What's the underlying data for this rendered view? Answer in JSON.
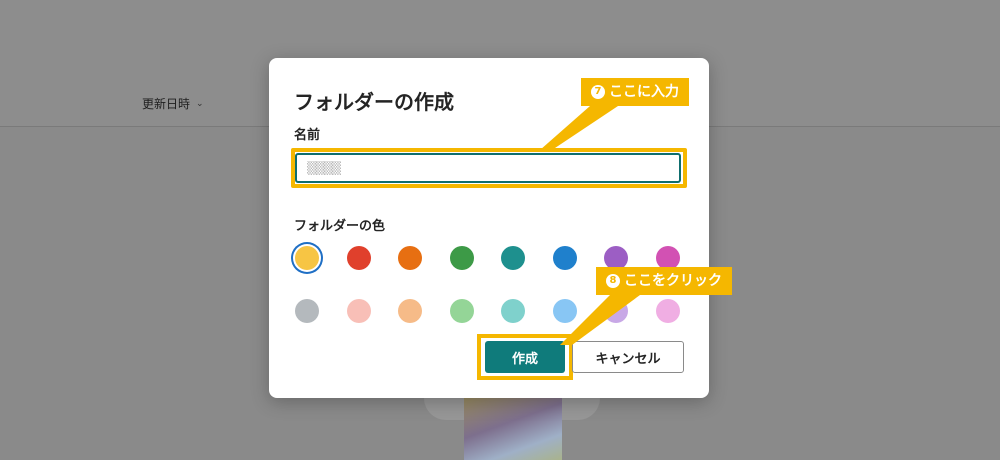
{
  "background": {
    "sort_label": "更新日時",
    "sort_icon": "chevron-down-icon"
  },
  "dialog": {
    "title": "フォルダーの作成",
    "name_label": "名前",
    "name_placeholder": "▒▒▒▒",
    "color_label": "フォルダーの色",
    "colors_row1": [
      "#f7c544",
      "#e0402c",
      "#e76f12",
      "#3d9a47",
      "#1e908e",
      "#1f80cc",
      "#9c5ec4",
      "#d251b3"
    ],
    "colors_row2": [
      "#b4b9bd",
      "#f8bfb7",
      "#f6bb88",
      "#94d597",
      "#7fd1cc",
      "#88c6f4",
      "#c8a8e6",
      "#f0aee3"
    ],
    "create_label": "作成",
    "cancel_label": "キャンセル"
  },
  "annotations": {
    "step7_num": "7",
    "step7_text": "ここに入力",
    "step8_num": "8",
    "step8_text": "ここをクリック",
    "highlight_color": "#f5b700"
  }
}
